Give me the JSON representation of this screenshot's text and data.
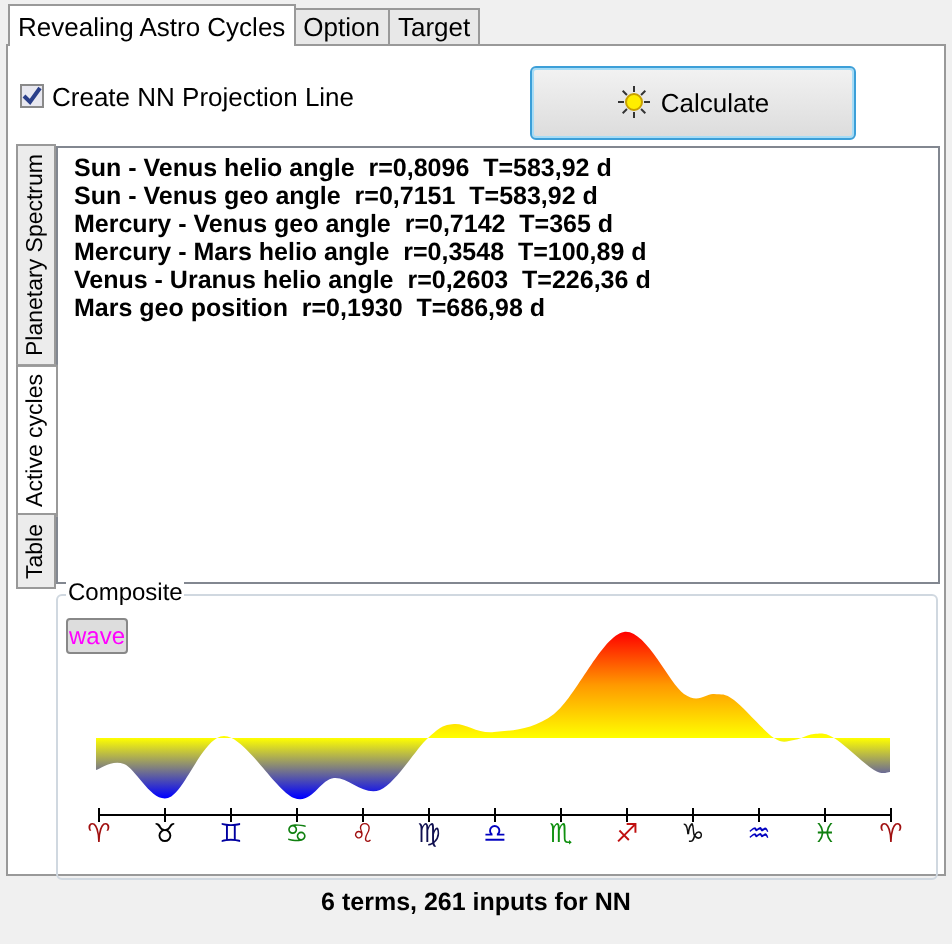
{
  "tabs": [
    {
      "label": "Revealing Astro Cycles",
      "selected": true
    },
    {
      "label": "Option",
      "selected": false
    },
    {
      "label": "Target",
      "selected": false
    }
  ],
  "projection_checkbox": {
    "label": "Create NN Projection Line",
    "checked": true
  },
  "calculate_button": {
    "label": "Calculate"
  },
  "side_tabs": [
    {
      "label": "Planetary Spectrum",
      "selected": false
    },
    {
      "label": "Active cycles",
      "selected": true
    },
    {
      "label": "Table",
      "selected": false
    }
  ],
  "cycles": [
    "Sun - Venus helio angle  r=0,8096  T=583,92 d",
    "Sun - Venus geo angle  r=0,7151  T=583,92 d",
    "Mercury - Venus geo angle  r=0,7142  T=365 d",
    "Mercury - Mars helio angle  r=0,3548  T=100,89 d",
    "Venus - Uranus helio angle  r=0,2603  T=226,36 d",
    "Mars geo position  r=0,1930  T=686,98 d"
  ],
  "composite": {
    "title": "Composite",
    "wave_button": "wave",
    "zodiac": [
      {
        "symbol": "♈",
        "color": "#a01010"
      },
      {
        "symbol": "♉",
        "color": "#000000"
      },
      {
        "symbol": "♊",
        "color": "#0000a0"
      },
      {
        "symbol": "♋",
        "color": "#108010"
      },
      {
        "symbol": "♌",
        "color": "#a01010"
      },
      {
        "symbol": "♍",
        "color": "#101050"
      },
      {
        "symbol": "♎",
        "color": "#0000c0"
      },
      {
        "symbol": "♏",
        "color": "#109010"
      },
      {
        "symbol": "♐",
        "color": "#c01010"
      },
      {
        "symbol": "♑",
        "color": "#101010"
      },
      {
        "symbol": "♒",
        "color": "#0000c0"
      },
      {
        "symbol": "♓",
        "color": "#108010"
      },
      {
        "symbol": "♈",
        "color": "#a01010"
      }
    ]
  },
  "status": "6 terms, 261 inputs for NN"
}
